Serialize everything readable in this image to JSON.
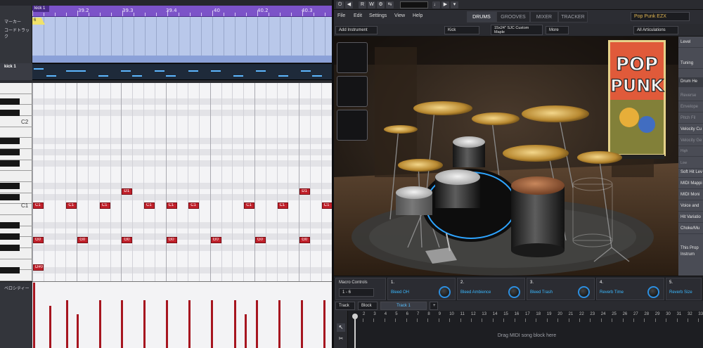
{
  "daw": {
    "ruler": {
      "current_label": "kick 1",
      "numbers": [
        "39.2",
        "39.3",
        "39.4",
        "40",
        "40.2",
        "40.3"
      ],
      "cursor_flag": "6"
    },
    "labels": {
      "marker": "マーカー",
      "chord_track": "コードトラック",
      "track_name": "kick 1",
      "velocity": "ベロシティー"
    },
    "keys": {
      "c2": "C2",
      "c1": "C1"
    },
    "notes": [
      {
        "pitch": "D1",
        "label": "D1",
        "beats": [
          8,
          24
        ]
      },
      {
        "pitch": "C1",
        "label": "C1",
        "beats": [
          0,
          3,
          6,
          10,
          12,
          14,
          19,
          22,
          26
        ]
      },
      {
        "pitch": "G0",
        "label": "G0",
        "beats": [
          0,
          4,
          8,
          12,
          16,
          20,
          24
        ]
      },
      {
        "pitch": "D#0",
        "label": "D#0",
        "beats": [
          0
        ]
      }
    ]
  },
  "ezd": {
    "transport": [
      "⏻",
      "◀",
      "R",
      "W",
      "⚙",
      "⇆"
    ],
    "menu": {
      "file": "File",
      "edit": "Edit",
      "settings": "Settings",
      "view": "View",
      "help": "Help"
    },
    "tabs": {
      "drums": "DRUMS",
      "grooves": "GROOVES",
      "mixer": "MIXER",
      "tracker": "TRACKER"
    },
    "preset": "Pop Punk EZX",
    "sub": {
      "add_instrument": "Add Instrument",
      "drum": "Kick",
      "size": "15x24\" SJC Custom",
      "size2": "Maple",
      "more": "More",
      "articulations": "All Articulations"
    },
    "side": {
      "level": "Level",
      "tuning": "Tuning",
      "drum_head": "Drum He",
      "reverse": "Reverse",
      "envelope": "Envelope",
      "pitch_fil": "Pitch Fil",
      "velocity_cu": "Velocity Cu",
      "velocity_ge": "Velocity Ge",
      "high": "High",
      "low": "Low",
      "soft_hit": "Soft Hit Lev",
      "midi_mapping": "MIDI Mappi",
      "midi_monitor": "MIDI Moni",
      "voice": "Voice and",
      "hit_variation": "Hit Variatio",
      "choke": "Choke/Mu",
      "info1": "This Prop",
      "info2": "Instrum"
    },
    "banner": {
      "line1": "POP",
      "line2": "PUNK"
    },
    "macro": {
      "title": "Macro Controls",
      "range": "1 - 6",
      "items": [
        {
          "num": "1.",
          "name": "Bleed OH"
        },
        {
          "num": "2.",
          "name": "Bleed Ambience"
        },
        {
          "num": "3.",
          "name": "Bleed Trash"
        },
        {
          "num": "4.",
          "name": "Reverb Time"
        },
        {
          "num": "5.",
          "name": "Reverb Size"
        }
      ]
    },
    "tracker": {
      "track": "Track",
      "block": "Block",
      "track1": "Track 1",
      "add": "+"
    },
    "timeline": {
      "numbers": [
        "2",
        "3",
        "4",
        "5",
        "6",
        "7",
        "8",
        "9",
        "10",
        "11",
        "12",
        "13",
        "14",
        "15",
        "16",
        "17",
        "18",
        "19",
        "20",
        "21",
        "22",
        "23",
        "24",
        "25",
        "26",
        "27",
        "28",
        "29",
        "30",
        "31",
        "32",
        "33"
      ],
      "hint": "Drag MIDI song block here"
    }
  }
}
